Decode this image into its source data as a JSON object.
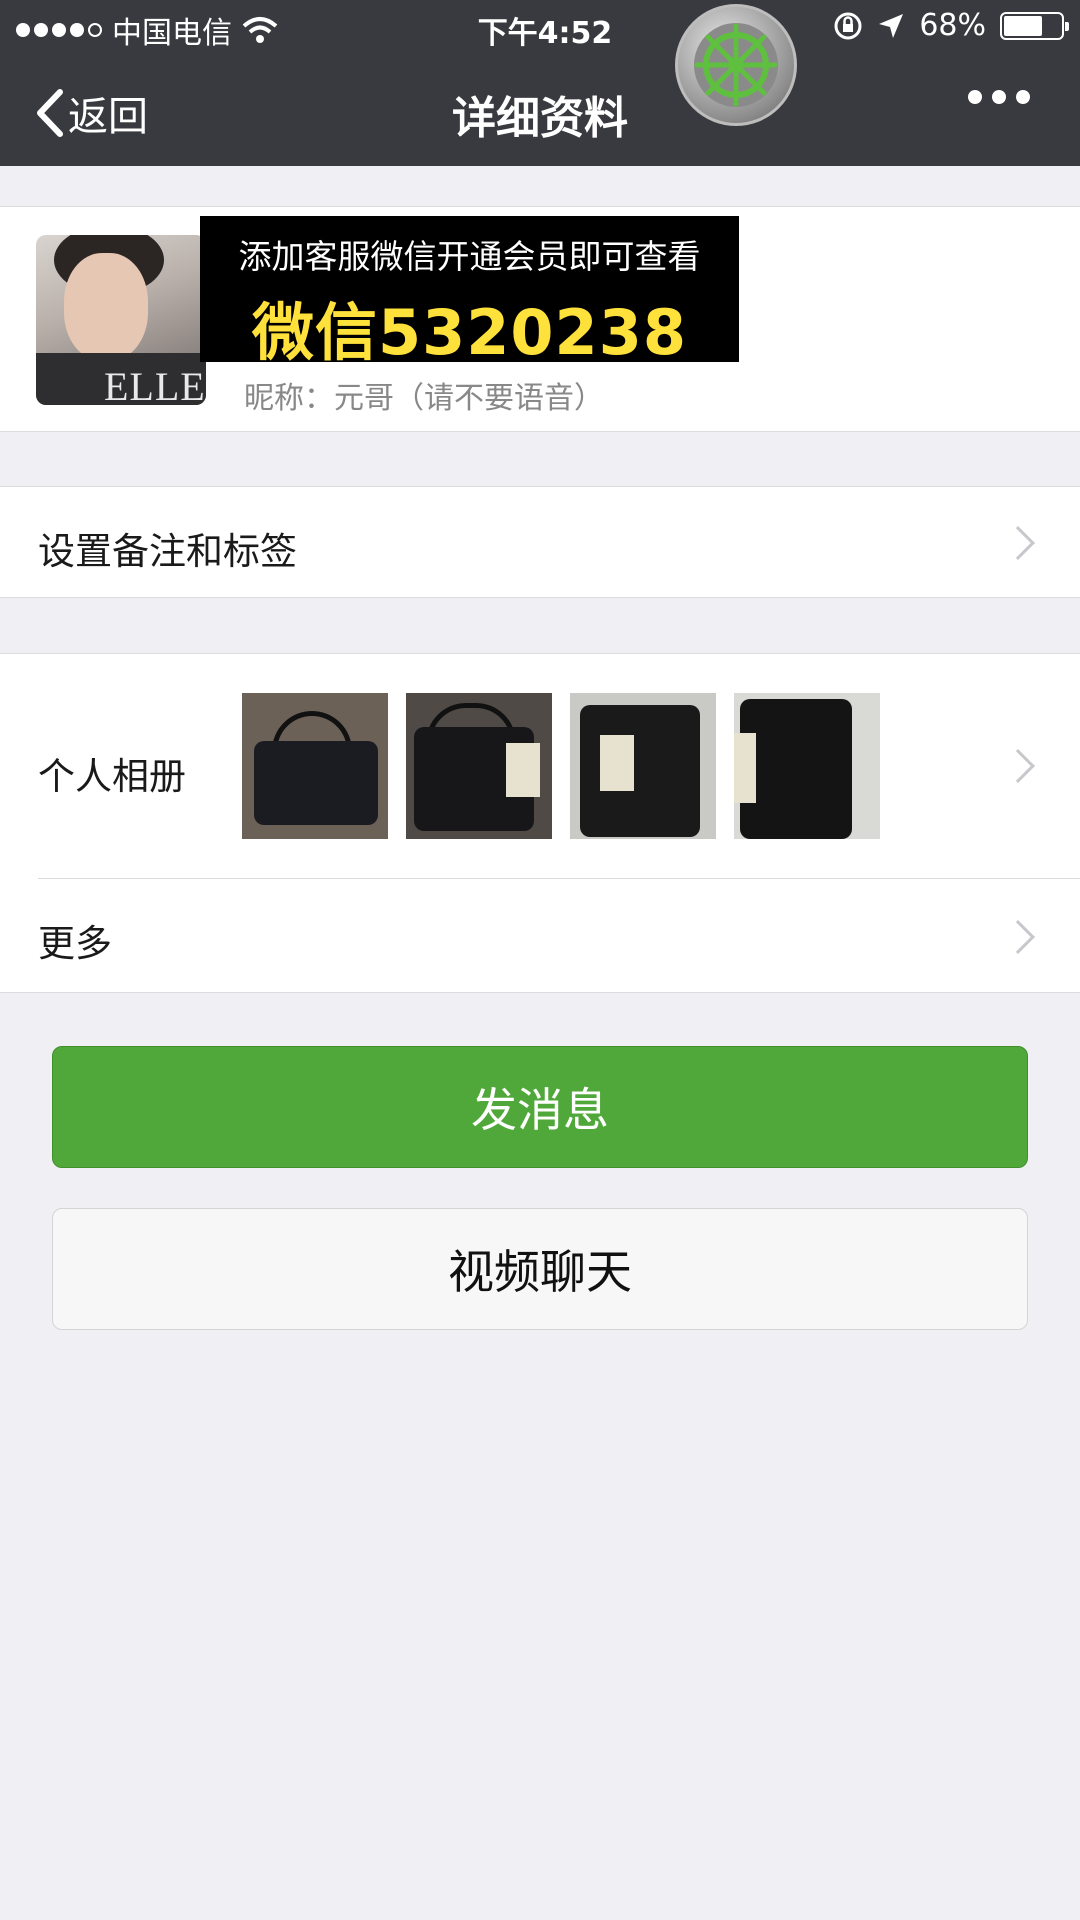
{
  "status_bar": {
    "carrier": "中国电信",
    "time": "下午4:52",
    "battery": "68%",
    "battery_level": 0.68
  },
  "nav": {
    "back_label": "返回",
    "title": "详细资料"
  },
  "profile": {
    "promo_line1": "添加客服微信开通会员即可查看",
    "promo_line2": "微信5320238",
    "nickname": "昵称：元哥（请不要语音）",
    "avatar_text": "ELLE"
  },
  "rows": {
    "remark_tags": "设置备注和标签",
    "album": "个人相册",
    "more": "更多"
  },
  "actions": {
    "send_message": "发消息",
    "video_chat": "视频聊天"
  },
  "colors": {
    "nav_bg": "#393a3f",
    "primary_green": "#50a83a",
    "promo_yellow": "#ffe13b",
    "page_bg": "#efeff4"
  }
}
